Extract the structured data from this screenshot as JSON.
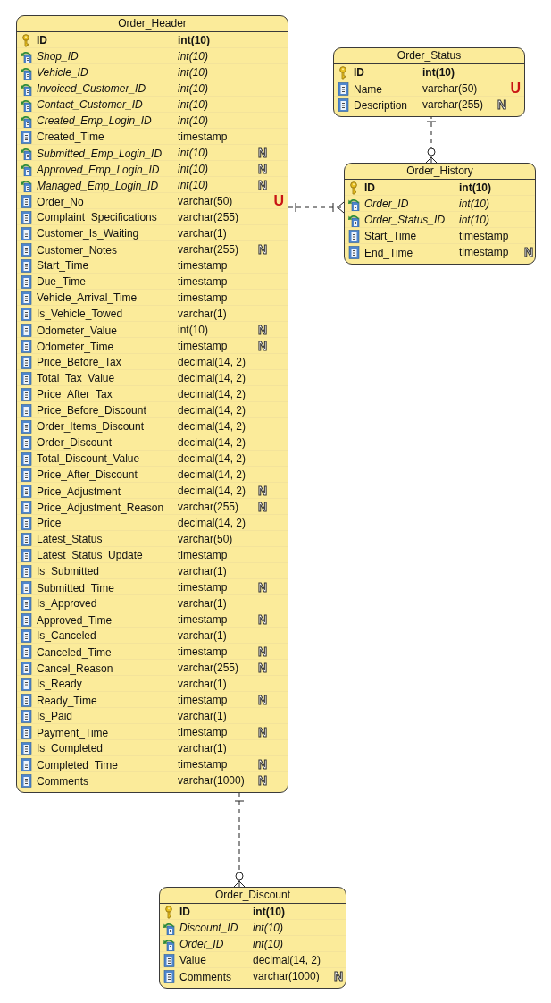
{
  "tables": [
    {
      "title": "Order_Header",
      "columns": [
        {
          "name": "ID",
          "type": "int(10)",
          "kind": "pk"
        },
        {
          "name": "Shop_ID",
          "type": "int(10)",
          "kind": "fk"
        },
        {
          "name": "Vehicle_ID",
          "type": "int(10)",
          "kind": "fk"
        },
        {
          "name": "Invoiced_Customer_ID",
          "type": "int(10)",
          "kind": "fk"
        },
        {
          "name": "Contact_Customer_ID",
          "type": "int(10)",
          "kind": "fk"
        },
        {
          "name": "Created_Emp_Login_ID",
          "type": "int(10)",
          "kind": "fk"
        },
        {
          "name": "Created_Time",
          "type": "timestamp",
          "kind": "col"
        },
        {
          "name": "Submitted_Emp_Login_ID",
          "type": "int(10)",
          "kind": "fk",
          "marker": {
            "text": "N",
            "kind": "nullable"
          }
        },
        {
          "name": "Approved_Emp_Login_ID",
          "type": "int(10)",
          "kind": "fk",
          "marker": {
            "text": "N",
            "kind": "nullable"
          }
        },
        {
          "name": "Managed_Emp_Login_ID",
          "type": "int(10)",
          "kind": "fk",
          "marker": {
            "text": "N",
            "kind": "nullable"
          }
        },
        {
          "name": "Order_No",
          "type": "varchar(50)",
          "kind": "col",
          "marker": {
            "text": "U",
            "kind": "unique"
          }
        },
        {
          "name": "Complaint_Specifications",
          "type": "varchar(255)",
          "kind": "col"
        },
        {
          "name": "Customer_Is_Waiting",
          "type": "varchar(1)",
          "kind": "col"
        },
        {
          "name": "Customer_Notes",
          "type": "varchar(255)",
          "kind": "col",
          "marker": {
            "text": "N",
            "kind": "nullable"
          }
        },
        {
          "name": "Start_Time",
          "type": "timestamp",
          "kind": "col"
        },
        {
          "name": "Due_Time",
          "type": "timestamp",
          "kind": "col"
        },
        {
          "name": "Vehicle_Arrival_Time",
          "type": "timestamp",
          "kind": "col"
        },
        {
          "name": "Is_Vehicle_Towed",
          "type": "varchar(1)",
          "kind": "col"
        },
        {
          "name": "Odometer_Value",
          "type": "int(10)",
          "kind": "col",
          "marker": {
            "text": "N",
            "kind": "nullable"
          }
        },
        {
          "name": "Odometer_Time",
          "type": "timestamp",
          "kind": "col",
          "marker": {
            "text": "N",
            "kind": "nullable"
          }
        },
        {
          "name": "Price_Before_Tax",
          "type": "decimal(14, 2)",
          "kind": "col"
        },
        {
          "name": "Total_Tax_Value",
          "type": "decimal(14, 2)",
          "kind": "col"
        },
        {
          "name": "Price_After_Tax",
          "type": "decimal(14, 2)",
          "kind": "col"
        },
        {
          "name": "Price_Before_Discount",
          "type": "decimal(14, 2)",
          "kind": "col"
        },
        {
          "name": "Order_Items_Discount",
          "type": "decimal(14, 2)",
          "kind": "col"
        },
        {
          "name": "Order_Discount",
          "type": "decimal(14, 2)",
          "kind": "col"
        },
        {
          "name": "Total_Discount_Value",
          "type": "decimal(14, 2)",
          "kind": "col"
        },
        {
          "name": "Price_After_Discount",
          "type": "decimal(14, 2)",
          "kind": "col"
        },
        {
          "name": "Price_Adjustment",
          "type": "decimal(14, 2)",
          "kind": "col",
          "marker": {
            "text": "N",
            "kind": "nullable"
          }
        },
        {
          "name": "Price_Adjustment_Reason",
          "type": "varchar(255)",
          "kind": "col",
          "marker": {
            "text": "N",
            "kind": "nullable"
          }
        },
        {
          "name": "Price",
          "type": "decimal(14, 2)",
          "kind": "col"
        },
        {
          "name": "Latest_Status",
          "type": "varchar(50)",
          "kind": "col"
        },
        {
          "name": "Latest_Status_Update",
          "type": "timestamp",
          "kind": "col"
        },
        {
          "name": "Is_Submitted",
          "type": "varchar(1)",
          "kind": "col"
        },
        {
          "name": "Submitted_Time",
          "type": "timestamp",
          "kind": "col",
          "marker": {
            "text": "N",
            "kind": "nullable"
          }
        },
        {
          "name": "Is_Approved",
          "type": "varchar(1)",
          "kind": "col"
        },
        {
          "name": "Approved_Time",
          "type": "timestamp",
          "kind": "col",
          "marker": {
            "text": "N",
            "kind": "nullable"
          }
        },
        {
          "name": "Is_Canceled",
          "type": "varchar(1)",
          "kind": "col"
        },
        {
          "name": "Canceled_Time",
          "type": "timestamp",
          "kind": "col",
          "marker": {
            "text": "N",
            "kind": "nullable"
          }
        },
        {
          "name": "Cancel_Reason",
          "type": "varchar(255)",
          "kind": "col",
          "marker": {
            "text": "N",
            "kind": "nullable"
          }
        },
        {
          "name": "Is_Ready",
          "type": "varchar(1)",
          "kind": "col"
        },
        {
          "name": "Ready_Time",
          "type": "timestamp",
          "kind": "col",
          "marker": {
            "text": "N",
            "kind": "nullable"
          }
        },
        {
          "name": "Is_Paid",
          "type": "varchar(1)",
          "kind": "col"
        },
        {
          "name": "Payment_Time",
          "type": "timestamp",
          "kind": "col",
          "marker": {
            "text": "N",
            "kind": "nullable"
          }
        },
        {
          "name": "Is_Completed",
          "type": "varchar(1)",
          "kind": "col"
        },
        {
          "name": "Completed_Time",
          "type": "timestamp",
          "kind": "col",
          "marker": {
            "text": "N",
            "kind": "nullable"
          }
        },
        {
          "name": "Comments",
          "type": "varchar(1000)",
          "kind": "col",
          "marker": {
            "text": "N",
            "kind": "nullable"
          }
        }
      ]
    },
    {
      "title": "Order_Status",
      "columns": [
        {
          "name": "ID",
          "type": "int(10)",
          "kind": "pk"
        },
        {
          "name": "Name",
          "type": "varchar(50)",
          "kind": "col",
          "marker": {
            "text": "U",
            "kind": "unique"
          }
        },
        {
          "name": "Description",
          "type": "varchar(255)",
          "kind": "col",
          "marker": {
            "text": "N",
            "kind": "nullable"
          }
        }
      ]
    },
    {
      "title": "Order_History",
      "columns": [
        {
          "name": "ID",
          "type": "int(10)",
          "kind": "pk"
        },
        {
          "name": "Order_ID",
          "type": "int(10)",
          "kind": "fk"
        },
        {
          "name": "Order_Status_ID",
          "type": "int(10)",
          "kind": "fk"
        },
        {
          "name": "Start_Time",
          "type": "timestamp",
          "kind": "col"
        },
        {
          "name": "End_Time",
          "type": "timestamp",
          "kind": "col",
          "marker": {
            "text": "N",
            "kind": "nullable"
          }
        }
      ]
    },
    {
      "title": "Order_Discount",
      "columns": [
        {
          "name": "ID",
          "type": "int(10)",
          "kind": "pk"
        },
        {
          "name": "Discount_ID",
          "type": "int(10)",
          "kind": "fk"
        },
        {
          "name": "Order_ID",
          "type": "int(10)",
          "kind": "fk"
        },
        {
          "name": "Value",
          "type": "decimal(14, 2)",
          "kind": "col"
        },
        {
          "name": "Comments",
          "type": "varchar(1000)",
          "kind": "col",
          "marker": {
            "text": "N",
            "kind": "nullable"
          }
        }
      ]
    }
  ]
}
